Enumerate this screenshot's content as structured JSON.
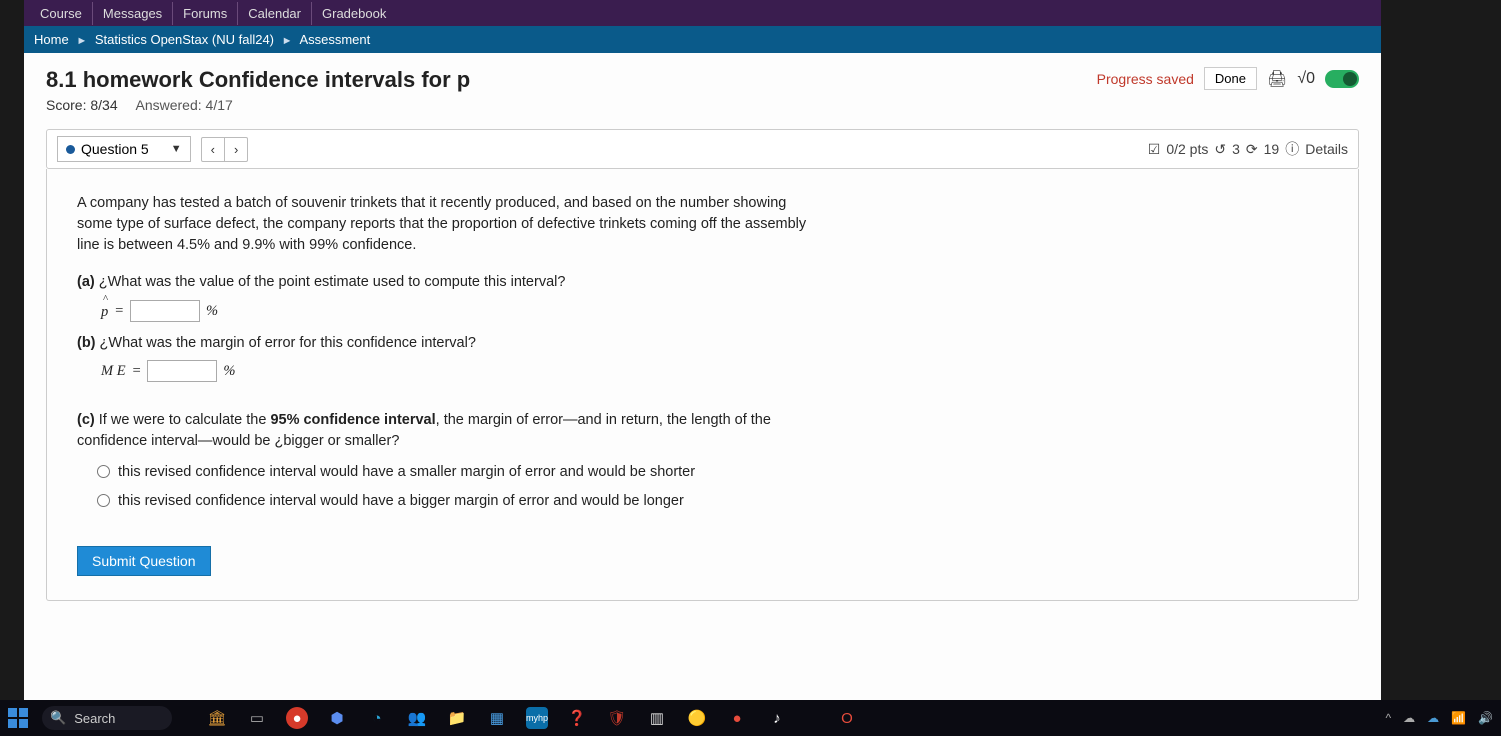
{
  "topnav": {
    "items": [
      "Course",
      "Messages",
      "Forums",
      "Calendar",
      "Gradebook"
    ]
  },
  "breadcrumb": {
    "home": "Home",
    "course": "Statistics OpenStax (NU fall24)",
    "page": "Assessment"
  },
  "header": {
    "title": "8.1 homework Confidence intervals for p",
    "score_label": "Score: 8/34",
    "answered_label": "Answered: 4/17",
    "progress_saved": "Progress saved",
    "done_label": "Done",
    "sqrt_label": "√0"
  },
  "questionbar": {
    "current": "Question 5",
    "points": "0/2 pts",
    "retries": "3",
    "attempts": "19",
    "details": "Details"
  },
  "question": {
    "intro": "A company has tested a batch of souvenir trinkets that it recently produced, and based on the number showing some type of surface defect, the company reports that the proportion of defective trinkets coming off the assembly line is between 4.5% and 9.9% with 99% confidence.",
    "a_prompt": "¿What was the value of the point estimate used to compute this interval?",
    "a_var": "p̂ =",
    "a_unit": "%",
    "b_prompt": "¿What was the margin of error for this confidence interval?",
    "b_var": "ME =",
    "b_unit": "%",
    "c_prompt_1": "If we were to calculate the ",
    "c_bold": "95% confidence interval",
    "c_prompt_2": ", the margin of error—and in return, the length of the confidence interval—would be ¿bigger or smaller?",
    "opt1": "this revised confidence interval would have a smaller margin of error and would be shorter",
    "opt2": "this revised confidence interval would have a bigger margin of error and would be longer",
    "submit": "Submit Question"
  },
  "taskbar": {
    "search_placeholder": "Search"
  }
}
